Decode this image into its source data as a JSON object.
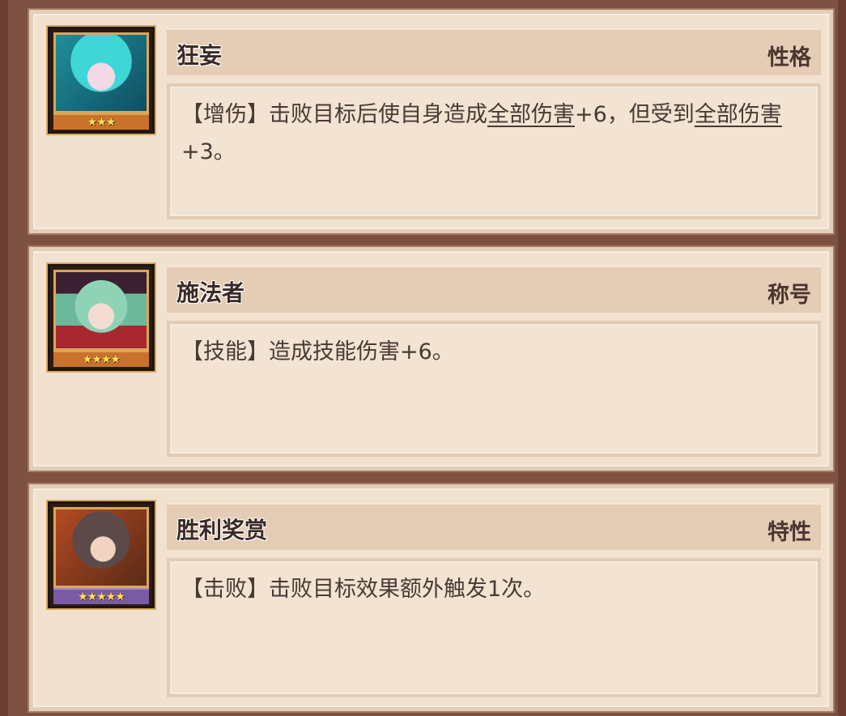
{
  "cards": [
    {
      "name": "狂妄",
      "type": "性格",
      "stars": "★★★",
      "desc_parts": [
        {
          "text": "【增伤】击败目标后使自身造成"
        },
        {
          "text": "全部伤害",
          "underline": true
        },
        {
          "text": "+6，但受到"
        },
        {
          "text": "全部伤害",
          "underline": true
        },
        {
          "text": "+3。"
        }
      ]
    },
    {
      "name": "施法者",
      "type": "称号",
      "stars": "★★★★",
      "desc_parts": [
        {
          "text": "【技能】造成技能伤害+6。"
        }
      ]
    },
    {
      "name": "胜利奖赏",
      "type": "特性",
      "stars": "★★★★★",
      "desc_parts": [
        {
          "text": "【击败】击败目标效果额外触发1次。"
        }
      ]
    }
  ],
  "colors": {
    "card_bg": "#f1e2d0",
    "header_bg": "#e4ccb5",
    "text": "#4a3935",
    "frame": "#7a4e3e"
  }
}
